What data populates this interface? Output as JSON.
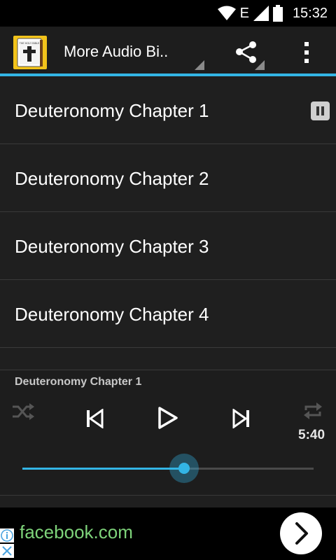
{
  "status_bar": {
    "time": "15:32",
    "network_type": "E",
    "icons": [
      "wifi-icon",
      "signal-icon",
      "battery-icon"
    ]
  },
  "action_bar": {
    "app_icon": "bible-icon",
    "app_icon_caption": "THE HOLY BIBLE",
    "title": "More Audio Bi..",
    "actions": [
      "share-icon",
      "overflow-menu-icon"
    ]
  },
  "chapters": [
    {
      "label": "Deuteronomy Chapter 1",
      "playing": true
    },
    {
      "label": "Deuteronomy Chapter 2",
      "playing": false
    },
    {
      "label": "Deuteronomy Chapter 3",
      "playing": false
    },
    {
      "label": "Deuteronomy Chapter 4",
      "playing": false
    }
  ],
  "player": {
    "now_playing": "Deuteronomy Chapter 1",
    "duration": "5:40",
    "progress_fraction": 0.555,
    "controls": [
      "shuffle-icon",
      "previous-icon",
      "play-icon",
      "next-icon",
      "repeat-icon"
    ]
  },
  "ad": {
    "text": "facebook.com",
    "icons": [
      "info-icon",
      "close-icon",
      "arrow-right-icon"
    ]
  },
  "colors": {
    "accent": "#33b5e5",
    "ad_text": "#7ed37a",
    "app_icon_bg": "#f2c31b"
  }
}
